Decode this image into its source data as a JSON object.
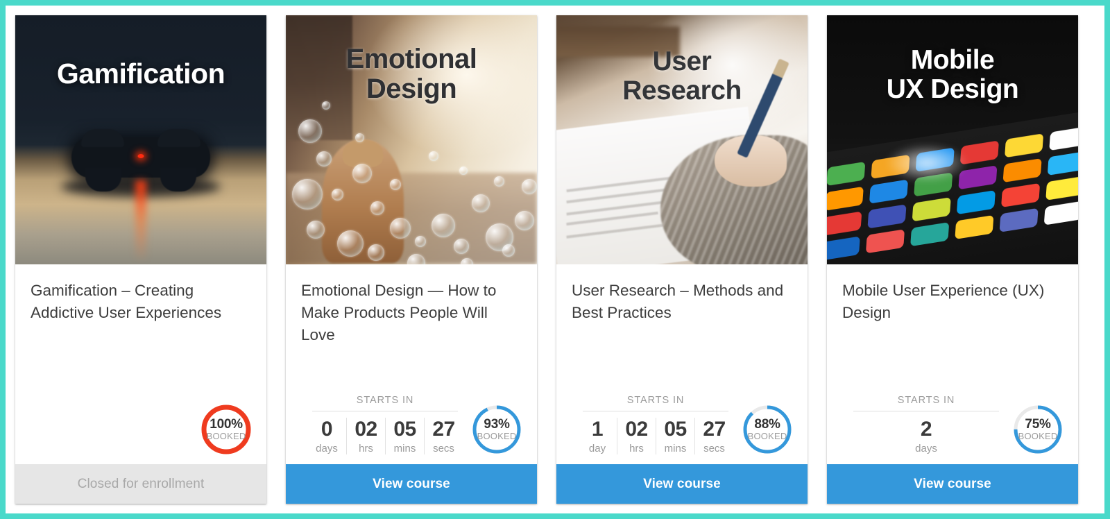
{
  "theme": {
    "page_border_color": "#4ad9ca",
    "page_background": "#ffffff",
    "accent_blue": "#3498db",
    "accent_red": "#ef3b1f",
    "ring_track": "#e9e9e9",
    "closed_footer_bg": "#e6e6e6"
  },
  "cards": [
    {
      "hero_title": "Gamification",
      "hero_style": "dark-gamepad-photo",
      "title": "Gamification – Creating Addictive User Experiences",
      "has_countdown": false,
      "starts_in_label": "",
      "countdown": [],
      "booked": {
        "percent": 100,
        "percent_label": "100%",
        "booked_label": "BOOKED",
        "color": "#ef3b1f"
      },
      "footer": {
        "label": "Closed for enrollment",
        "state": "closed"
      }
    },
    {
      "hero_title": "Emotional Design",
      "hero_style": "bubbles-street-photo",
      "title": "Emotional Design — How to Make Products People Will Love",
      "has_countdown": true,
      "starts_in_label": "STARTS IN",
      "countdown": [
        {
          "value": "0",
          "unit": "days"
        },
        {
          "value": "02",
          "unit": "hrs"
        },
        {
          "value": "05",
          "unit": "mins"
        },
        {
          "value": "27",
          "unit": "secs"
        }
      ],
      "booked": {
        "percent": 93,
        "percent_label": "93%",
        "booked_label": "BOOKED",
        "color": "#3498db"
      },
      "footer": {
        "label": "View course",
        "state": "active"
      }
    },
    {
      "hero_title": "User Research",
      "hero_style": "hand-writing-photo",
      "title": "User Research – Methods and Best Practices",
      "has_countdown": true,
      "starts_in_label": "STARTS IN",
      "countdown": [
        {
          "value": "1",
          "unit": "day"
        },
        {
          "value": "02",
          "unit": "hrs"
        },
        {
          "value": "05",
          "unit": "mins"
        },
        {
          "value": "27",
          "unit": "secs"
        }
      ],
      "booked": {
        "percent": 88,
        "percent_label": "88%",
        "booked_label": "BOOKED",
        "color": "#3498db"
      },
      "footer": {
        "label": "View course",
        "state": "active"
      }
    },
    {
      "hero_title": "Mobile UX Design",
      "hero_style": "dark-phone-apps-photo",
      "title": "Mobile User Experience (UX) Design",
      "has_countdown": true,
      "starts_in_label": "STARTS IN",
      "countdown": [
        {
          "value": "2",
          "unit": "days"
        }
      ],
      "booked": {
        "percent": 75,
        "percent_label": "75%",
        "booked_label": "BOOKED",
        "color": "#3498db"
      },
      "footer": {
        "label": "View course",
        "state": "active"
      }
    }
  ]
}
